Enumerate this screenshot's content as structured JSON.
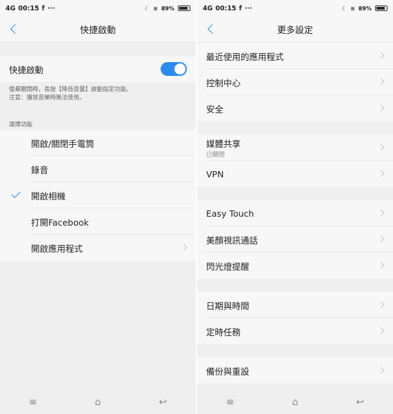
{
  "status": {
    "network": "4G",
    "time": "00:15",
    "battery": "89%"
  },
  "left": {
    "title": "快捷啟動",
    "toggle": {
      "label": "快捷啟動",
      "on": true
    },
    "description": [
      "螢幕關閉時，長按【降低音量】啟動指定功能。",
      "注意：播放音樂時無法使用。"
    ],
    "section_label": "選擇功能",
    "options": [
      {
        "label": "開啟/關閉手電筒"
      },
      {
        "label": "錄音"
      },
      {
        "label": "開啟相機",
        "selected": true
      },
      {
        "label": "打開Facebook"
      },
      {
        "label": "開啟應用程式"
      }
    ]
  },
  "right": {
    "title": "更多設定",
    "groups": [
      [
        {
          "label": "最近使用的應用程式"
        },
        {
          "label": "控制中心"
        },
        {
          "label": "安全"
        }
      ],
      [
        {
          "label": "媒體共享",
          "sub": "已關閉"
        },
        {
          "label": "VPN"
        }
      ],
      [
        {
          "label": "Easy Touch"
        },
        {
          "label": "美顏視訊通話"
        },
        {
          "label": "閃光燈提醒"
        }
      ],
      [
        {
          "label": "日期與時間"
        },
        {
          "label": "定時任務"
        }
      ],
      [
        {
          "label": "備份與重設"
        }
      ]
    ]
  },
  "nav": {
    "menu": "≡",
    "home": "⌂",
    "back": "↩"
  },
  "accent": "#2a8cf0"
}
